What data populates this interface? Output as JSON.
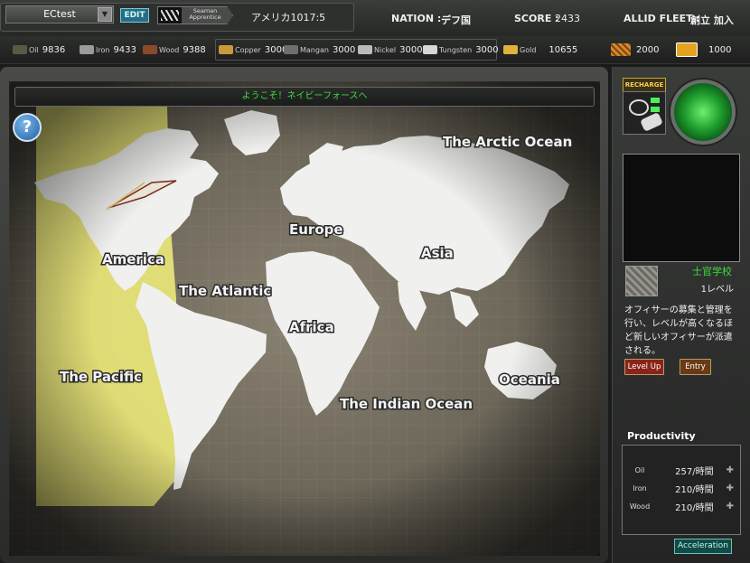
{
  "header": {
    "username": "ECtest",
    "edit_label": "EDIT",
    "rank": "Seaman Apprentice",
    "country": "アメリカ1017:5",
    "nation_label": "NATION :",
    "nation_value": "デフ国",
    "score_label": "SCORE :",
    "score_value": "2433",
    "fleet_label": "ALLID FLEET :",
    "fleet_value": "創立 加入"
  },
  "resources": [
    {
      "name": "Oil",
      "value": "9836",
      "color": "#3a3a2a"
    },
    {
      "name": "Iron",
      "value": "9433",
      "color": "#8a8a8a"
    },
    {
      "name": "Wood",
      "value": "9388",
      "color": "#8b4a2a"
    },
    {
      "name": "Copper",
      "value": "3000",
      "color": "#c89a3a"
    },
    {
      "name": "Mangan",
      "value": "3000",
      "color": "#777777"
    },
    {
      "name": "Nickel",
      "value": "3000",
      "color": "#bbbbbb"
    },
    {
      "name": "Tungsten",
      "value": "3000",
      "color": "#d7d7d7"
    },
    {
      "name": "Gold",
      "value": "10655",
      "color": "#e0b23a"
    }
  ],
  "extras": [
    {
      "value": "2000",
      "color": "#d8862a"
    },
    {
      "value": "1000",
      "color": "#e6a21f"
    }
  ],
  "map": {
    "welcome": "ようこそ！ネイビーフォースへ",
    "labels": [
      "The Arctic Ocean",
      "Europe",
      "America",
      "Asia",
      "The Atlantic",
      "Africa",
      "The Pacific",
      "Oceania",
      "The Indian Ocean"
    ]
  },
  "sidebar": {
    "recharge_label": "RECHARGE",
    "officer_school": "士官学校",
    "officer_level": "1レベル",
    "officer_desc": "オフィサーの募集と管理を行い、レベルが高くなるほど新しいオフィサーが派遣される。",
    "levelup_label": "Level Up",
    "entry_label": "Entry",
    "productivity_title": "Productivity",
    "productivity": [
      {
        "name": "Oil",
        "value": "257/時間"
      },
      {
        "name": "Iron",
        "value": "210/時間"
      },
      {
        "name": "Wood",
        "value": "210/時間"
      }
    ],
    "acceleration_label": "Acceleration"
  }
}
